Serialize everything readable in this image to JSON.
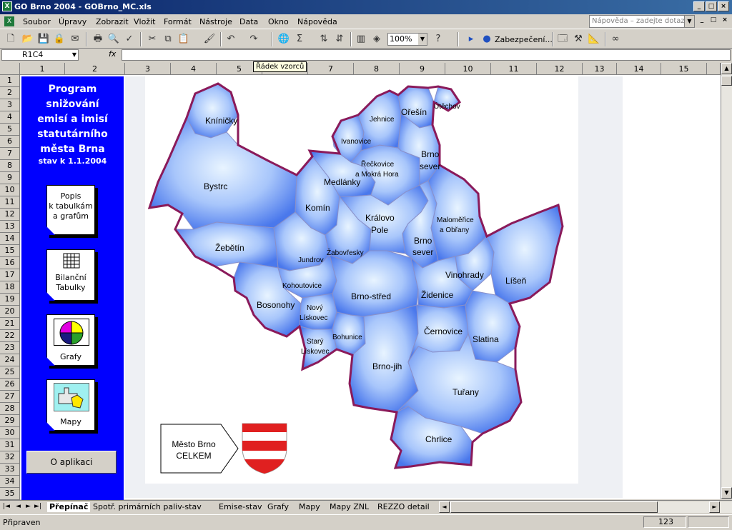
{
  "window": {
    "title": "GO Brno 2004 - GOBrno_MC.xls"
  },
  "menubar": {
    "items": [
      "Soubor",
      "Úpravy",
      "Zobrazit",
      "Vložit",
      "Formát",
      "Nástroje",
      "Data",
      "Okno",
      "Nápověda"
    ],
    "help_placeholder": "Nápověda – zadejte dotaz"
  },
  "toolbar": {
    "zoom": "100%",
    "security_label": "Zabezpečení..."
  },
  "formulabar": {
    "namebox": "R1C4",
    "fx": "fx",
    "tooltip": "Řádek vzorců"
  },
  "columns": [
    "1",
    "2",
    "3",
    "4",
    "5",
    "6",
    "7",
    "8",
    "9",
    "10",
    "11",
    "12",
    "13",
    "14",
    "15"
  ],
  "rows": [
    "1",
    "2",
    "3",
    "4",
    "5",
    "6",
    "7",
    "8",
    "9",
    "10",
    "11",
    "12",
    "13",
    "14",
    "15",
    "16",
    "17",
    "18",
    "19",
    "20",
    "21",
    "22",
    "23",
    "24",
    "25",
    "26",
    "27",
    "28",
    "29",
    "30",
    "31",
    "32",
    "33",
    "34",
    "35"
  ],
  "panel": {
    "title_lines": [
      "Program",
      "snižování",
      "emisí a imisí",
      "statutárního",
      "města Brna"
    ],
    "subtitle": "stav k 1.1.2004",
    "card_popis": [
      "Popis",
      "k tabulkám",
      "a grafům"
    ],
    "card_bilancni": [
      "Bilanční",
      "Tabulky"
    ],
    "card_grafy": "Grafy",
    "card_mapy": "Mapy",
    "about_button": "O aplikaci"
  },
  "map": {
    "districts": {
      "kninicky": "Kníničky",
      "bystrc": "Bystrc",
      "zebetin": "Žebětín",
      "bosonohy": "Bosonohy",
      "komin": "Komín",
      "medlanky": "Medlánky",
      "jundrov": "Jundrov",
      "zabovresky": "Žabovřesky",
      "kohoutovice": "Kohoutovice",
      "novy_1": "Nový",
      "novy_2": "Lískovec",
      "stary_1": "Starý",
      "stary_2": "Lískovec",
      "bohunice": "Bohunice",
      "brno_stred": "Brno-střed",
      "brno_jih": "Brno-jih",
      "kralovo_1": "Královo",
      "kralovo_2": "Pole",
      "reckovice_1": "Řečkovice",
      "reckovice_2": "a Mokrá Hora",
      "ivanovice": "Ivanovice",
      "jehnice": "Jehnice",
      "oresin": "Ořešín",
      "utechov": "Útěchov",
      "brno_sever1_1": "Brno",
      "brno_sever1_2": "sever",
      "brno_sever2_1": "Brno",
      "brno_sever2_2": "sever",
      "malomerice_1": "Maloměřice",
      "malomerice_2": "a Obřany",
      "vinohrady": "Vinohrady",
      "lisen": "Líšeň",
      "zidenice": "Židenice",
      "cernovice": "Černovice",
      "slatina": "Slatina",
      "turany": "Tuřany",
      "chrlice": "Chrlice"
    },
    "city_button": [
      "Město Brno",
      "CELKEM"
    ]
  },
  "sheet_tabs": [
    "Přepínač",
    "Spotř. primárních paliv-stav",
    "Emise-stav",
    "Grafy",
    "Mapy",
    "Mapy ZNL",
    "REZZO detail"
  ],
  "status": {
    "text": "Připraven",
    "num": "123"
  },
  "colors": {
    "panel": "#0000ff",
    "map_border": "#8a1a5a",
    "map_fill": "#5b86ef",
    "coat_red": "#e02020"
  }
}
